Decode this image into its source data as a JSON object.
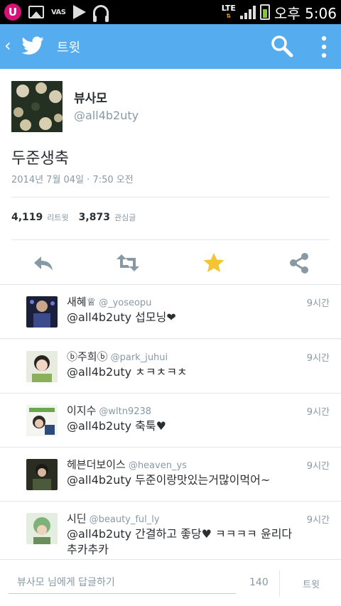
{
  "status_bar": {
    "carrier_badge": "U",
    "vas_label": "VAS",
    "network": "LTE",
    "time": "오후 5:06",
    "icons": [
      "carrier-icon",
      "gallery-icon",
      "vas-icon",
      "play-icon",
      "headphones-icon",
      "signal-icon",
      "battery-icon"
    ]
  },
  "header": {
    "title": "트윗",
    "icons": [
      "back-icon",
      "twitter-bird-icon",
      "search-icon",
      "overflow-menu-icon"
    ],
    "color": "#55acee"
  },
  "tweet": {
    "author_name": "뷰사모",
    "author_handle": "@all4b2uty",
    "text": "두준생축",
    "date": "2014년 7월 04일 · 7:50 오전",
    "retweet_count": "4,119",
    "retweet_label": "리트윗",
    "favorite_count": "3,873",
    "favorite_label": "관심글"
  },
  "actions": {
    "icons": [
      "reply-icon",
      "retweet-icon",
      "favorite-star-icon",
      "share-icon"
    ],
    "favorite_color": "#f4c433"
  },
  "replies": [
    {
      "name": "새혜♕",
      "handle": "@_yoseopu",
      "time": "9시간",
      "text": "@all4b2uty 섭모닝❤"
    },
    {
      "name": "ⓑ주희ⓑ",
      "handle": "@park_juhui",
      "time": "9시간",
      "text": "@all4b2uty ㅊㅋㅊㅋㅊ"
    },
    {
      "name": "이지수",
      "handle": "@wltn9238",
      "time": "9시간",
      "text": "@all4b2uty 축툭♥"
    },
    {
      "name": "헤븐더보이스",
      "handle": "@heaven_ys",
      "time": "9시간",
      "text": "@all4b2uty 두준이랑맛있는거많이먹어~"
    },
    {
      "name": "시딘",
      "handle": "@beauty_ful_ly",
      "time": "9시간",
      "text": "@all4b2uty 간결하고 좋당♥ ㅋㅋㅋㅋ 윤리다 추카추카"
    }
  ],
  "compose": {
    "placeholder": "뷰사모 님에게 답글하기",
    "char_count": "140",
    "send_label": "트윗"
  }
}
